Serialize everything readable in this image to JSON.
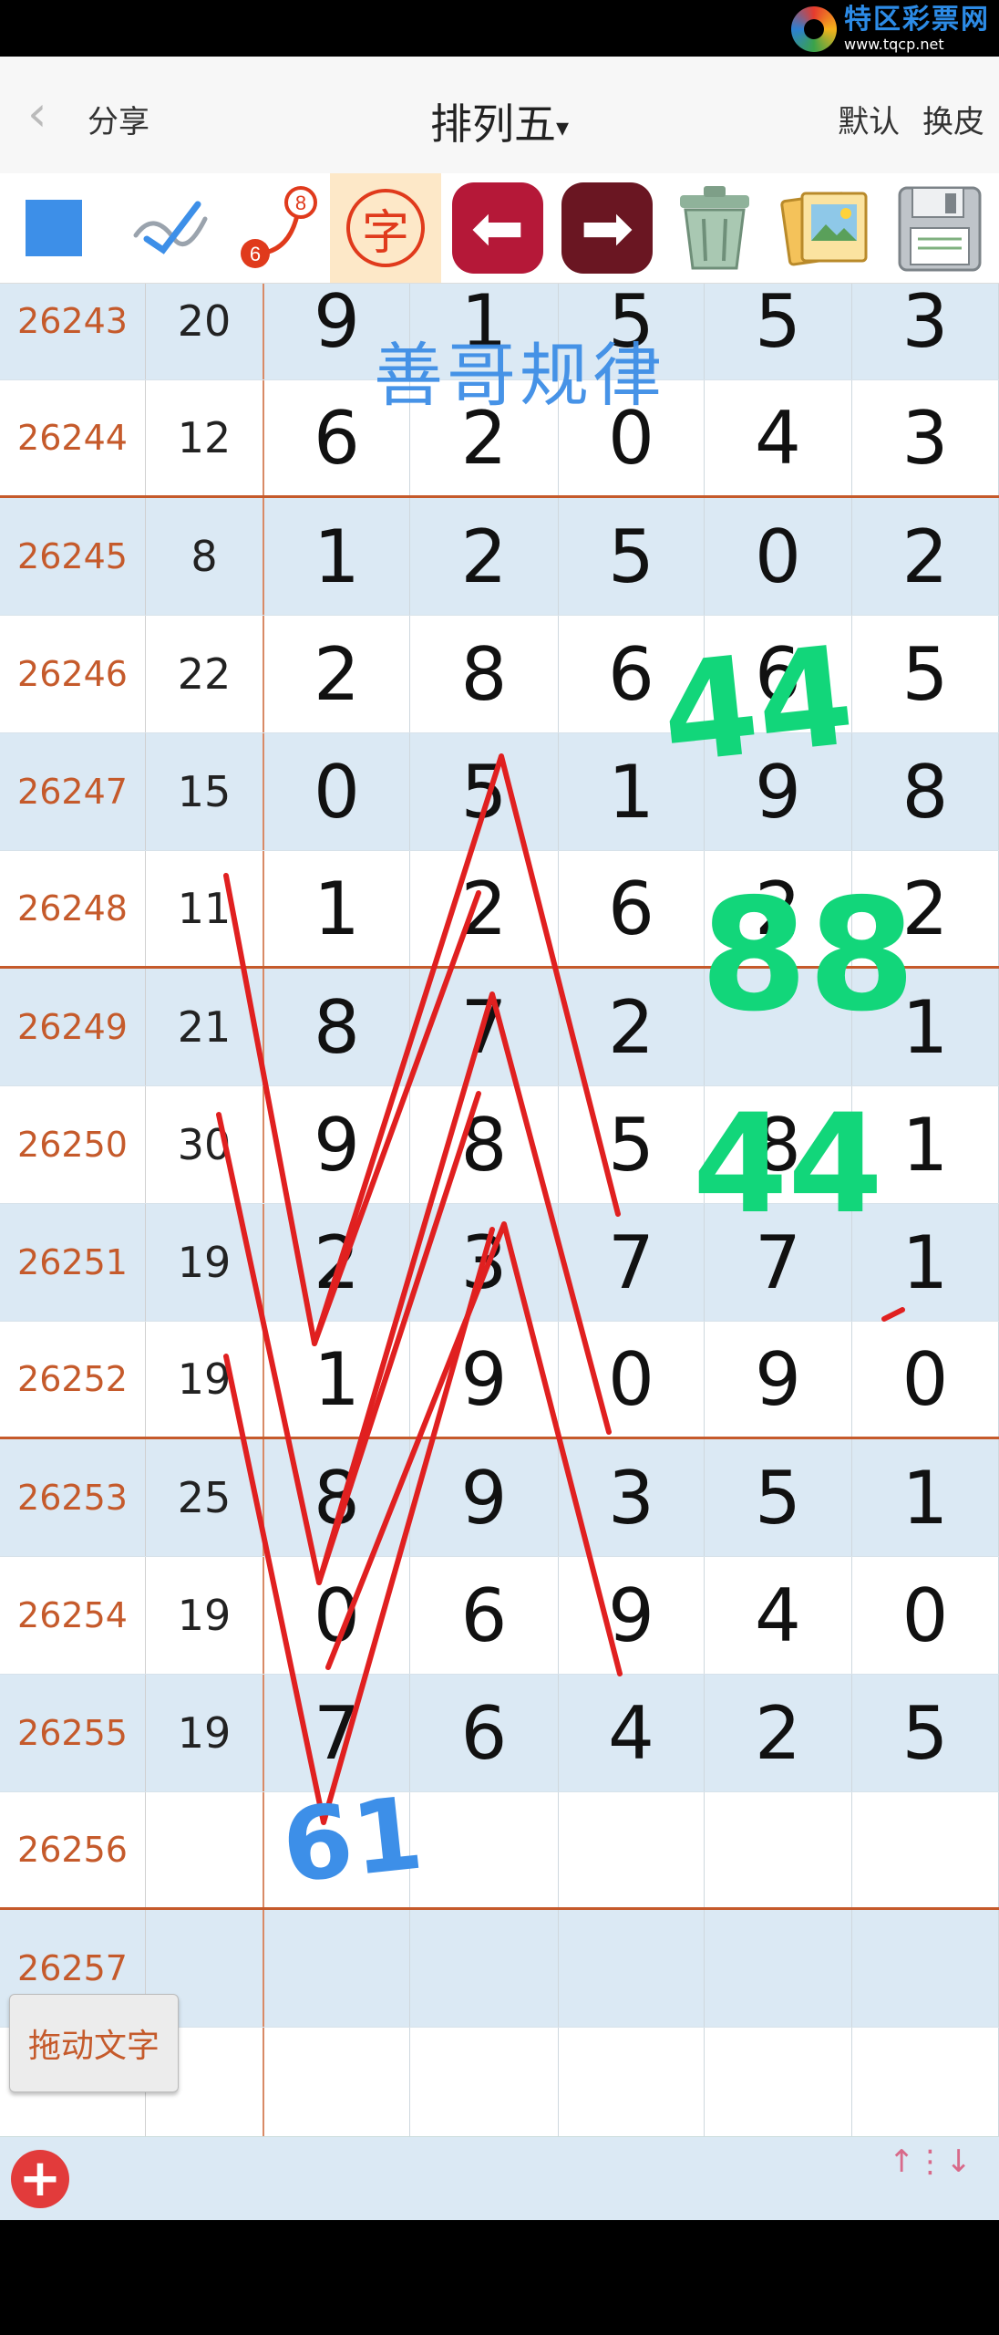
{
  "brand": {
    "name": "特区彩票网",
    "url": "www.tqcp.net"
  },
  "nav": {
    "back_icon": "‹",
    "share": "分享",
    "title": "排列五",
    "title_caret": "▾",
    "default": "默认",
    "skin": "换皮"
  },
  "toolbar": {
    "zi": "字",
    "left_arrow": "⬅",
    "right_arrow": "➡",
    "badge_top": "8",
    "badge_bottom": "6"
  },
  "colors": {
    "accent_blue": "#3d8fe8",
    "period_orange": "#c55a2b",
    "row_blue": "#dbe9f4",
    "draw_red": "#e02020",
    "draw_green": "#12d67a"
  },
  "rows": [
    {
      "period": "26243",
      "sum": "20",
      "digits": [
        "9",
        "1",
        "5",
        "5",
        "3"
      ],
      "sep": false
    },
    {
      "period": "26244",
      "sum": "12",
      "digits": [
        "6",
        "2",
        "0",
        "4",
        "3"
      ],
      "sep": true
    },
    {
      "period": "26245",
      "sum": "8",
      "digits": [
        "1",
        "2",
        "5",
        "0",
        "2"
      ],
      "sep": false
    },
    {
      "period": "26246",
      "sum": "22",
      "digits": [
        "2",
        "8",
        "6",
        "6",
        "5"
      ],
      "sep": false
    },
    {
      "period": "26247",
      "sum": "15",
      "digits": [
        "0",
        "5",
        "1",
        "9",
        "8"
      ],
      "sep": false
    },
    {
      "period": "26248",
      "sum": "11",
      "digits": [
        "1",
        "2",
        "6",
        "2",
        "2"
      ],
      "sep": true
    },
    {
      "period": "26249",
      "sum": "21",
      "digits": [
        "8",
        "7",
        "2",
        "",
        "1"
      ],
      "sep": false
    },
    {
      "period": "26250",
      "sum": "30",
      "digits": [
        "9",
        "8",
        "5",
        "8",
        "1"
      ],
      "sep": false
    },
    {
      "period": "26251",
      "sum": "19",
      "digits": [
        "2",
        "3",
        "7",
        "7",
        "1"
      ],
      "sep": false
    },
    {
      "period": "26252",
      "sum": "19",
      "digits": [
        "1",
        "9",
        "0",
        "9",
        "0"
      ],
      "sep": true
    },
    {
      "period": "26253",
      "sum": "25",
      "digits": [
        "8",
        "9",
        "3",
        "5",
        "1"
      ],
      "sep": false
    },
    {
      "period": "26254",
      "sum": "19",
      "digits": [
        "0",
        "6",
        "9",
        "4",
        "0"
      ],
      "sep": false
    },
    {
      "period": "26255",
      "sum": "19",
      "digits": [
        "7",
        "6",
        "4",
        "2",
        "5"
      ],
      "sep": false
    },
    {
      "period": "26256",
      "sum": "",
      "digits": [
        "",
        "",
        "",
        "",
        ""
      ],
      "sep": true
    },
    {
      "period": "26257",
      "sum": "",
      "digits": [
        "",
        "",
        "",
        "",
        ""
      ],
      "sep": false
    },
    {
      "period": "",
      "sum": "",
      "digits": [
        "",
        "",
        "",
        "",
        ""
      ],
      "sep": false
    }
  ],
  "annotations": {
    "watermark": "善哥规律",
    "green_1": "44",
    "green_2": "88",
    "green_3": "44",
    "blue_mark": "61"
  },
  "drag_button": "拖动文字",
  "footer": {
    "plus": "+",
    "updown": "↑⋮↓"
  }
}
